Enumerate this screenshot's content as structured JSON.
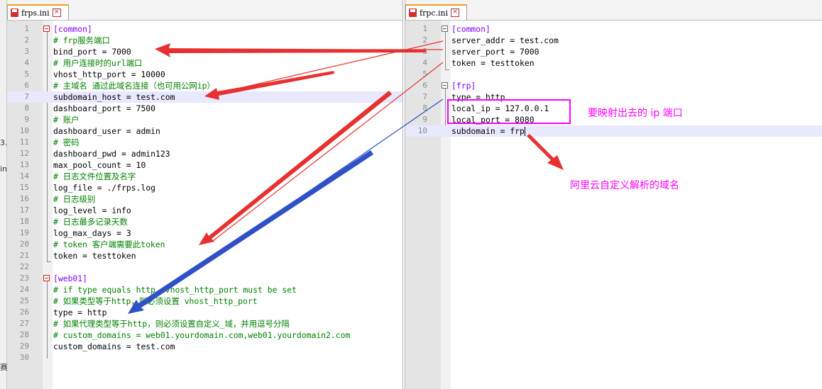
{
  "left_editor": {
    "tab_label": "frps.ini",
    "close_glyph": "×",
    "lines": [
      {
        "n": "1",
        "type": "section",
        "text": "[common]"
      },
      {
        "n": "2",
        "type": "comment",
        "text": "# frp服务端口"
      },
      {
        "n": "3",
        "type": "kv",
        "key": "bind_port",
        "value": "7000"
      },
      {
        "n": "4",
        "type": "comment",
        "text": "# 用户连接时的url端口"
      },
      {
        "n": "5",
        "type": "kv",
        "key": "vhost_http_port",
        "value": "10000"
      },
      {
        "n": "6",
        "type": "comment",
        "text": "# 主域名 通过此域名连接（也可用公网ip）"
      },
      {
        "n": "7",
        "type": "kv",
        "key": "subdomain_host",
        "value": "test.com",
        "highlight": true
      },
      {
        "n": "8",
        "type": "kv",
        "key": "dashboard_port",
        "value": "7500"
      },
      {
        "n": "9",
        "type": "comment",
        "text": "# 账户"
      },
      {
        "n": "10",
        "type": "kv",
        "key": "dashboard_user",
        "value": "admin"
      },
      {
        "n": "11",
        "type": "comment",
        "text": "# 密码"
      },
      {
        "n": "12",
        "type": "kv",
        "key": "dashboard_pwd",
        "value": "admin123"
      },
      {
        "n": "13",
        "type": "kv",
        "key": "max_pool_count",
        "value": "10"
      },
      {
        "n": "14",
        "type": "comment",
        "text": "# 日志文件位置及名字"
      },
      {
        "n": "15",
        "type": "kv",
        "key": "log_file",
        "value": "./frps.log"
      },
      {
        "n": "16",
        "type": "comment",
        "text": "# 日志级别"
      },
      {
        "n": "17",
        "type": "kv",
        "key": "log_level",
        "value": "info"
      },
      {
        "n": "18",
        "type": "comment",
        "text": "# 日志最多记录天数"
      },
      {
        "n": "19",
        "type": "kv",
        "key": "log_max_days",
        "value": "3"
      },
      {
        "n": "20",
        "type": "comment",
        "text": "# token 客户端需要此token"
      },
      {
        "n": "21",
        "type": "kv",
        "key": "token",
        "value": "testtoken"
      },
      {
        "n": "22",
        "type": "blank",
        "text": ""
      },
      {
        "n": "23",
        "type": "section",
        "text": "[web01]"
      },
      {
        "n": "24",
        "type": "comment",
        "text": "# if type equals http, vhost_http_port must be set"
      },
      {
        "n": "25",
        "type": "comment",
        "text": "# 如果类型等于http，则必须设置 vhost_http_port"
      },
      {
        "n": "26",
        "type": "kv",
        "key": "type",
        "value": "http"
      },
      {
        "n": "27",
        "type": "comment",
        "text": "# 如果代理类型等于http，则必须设置自定义_域，并用逗号分隔"
      },
      {
        "n": "28",
        "type": "comment",
        "text": "# custom_domains = web01.yourdomain.com,web01.yourdomain2.com"
      },
      {
        "n": "29",
        "type": "kv",
        "key": "custom_domains",
        "value": "test.com"
      },
      {
        "n": "30",
        "type": "blank",
        "text": ""
      }
    ]
  },
  "right_editor": {
    "tab_label": "frpc.ini",
    "close_glyph": "×",
    "lines": [
      {
        "n": "1",
        "type": "section",
        "text": "[common]"
      },
      {
        "n": "2",
        "type": "kv",
        "key": "server_addr",
        "value": "test.com"
      },
      {
        "n": "3",
        "type": "kv",
        "key": "server_port",
        "value": "7000"
      },
      {
        "n": "4",
        "type": "kv",
        "key": "token",
        "value": "testtoken"
      },
      {
        "n": "5",
        "type": "blank",
        "text": ""
      },
      {
        "n": "6",
        "type": "section",
        "text": "[frp]"
      },
      {
        "n": "7",
        "type": "kv",
        "key": "type",
        "value": "http"
      },
      {
        "n": "8",
        "type": "kv",
        "key": "local_ip",
        "value": "127.0.0.1"
      },
      {
        "n": "9",
        "type": "kv",
        "key": "local_port",
        "value": "8080"
      },
      {
        "n": "10",
        "type": "kv",
        "key": "subdomain",
        "value": "frp",
        "highlight": true,
        "cursor": true
      }
    ]
  },
  "annotations": {
    "ip_port_note": "要映射出去的 ip 端口",
    "domain_note": "阿里云自定义解析的域名"
  },
  "edge_fragments": [
    "3.",
    "in",
    "赛"
  ],
  "colors": {
    "comment": "#008000",
    "section": "#8000ff",
    "arrow_red": "#e83030",
    "arrow_blue": "#3050c8",
    "annotation": "#ff00ff",
    "current_line": "#e8e8ff"
  }
}
